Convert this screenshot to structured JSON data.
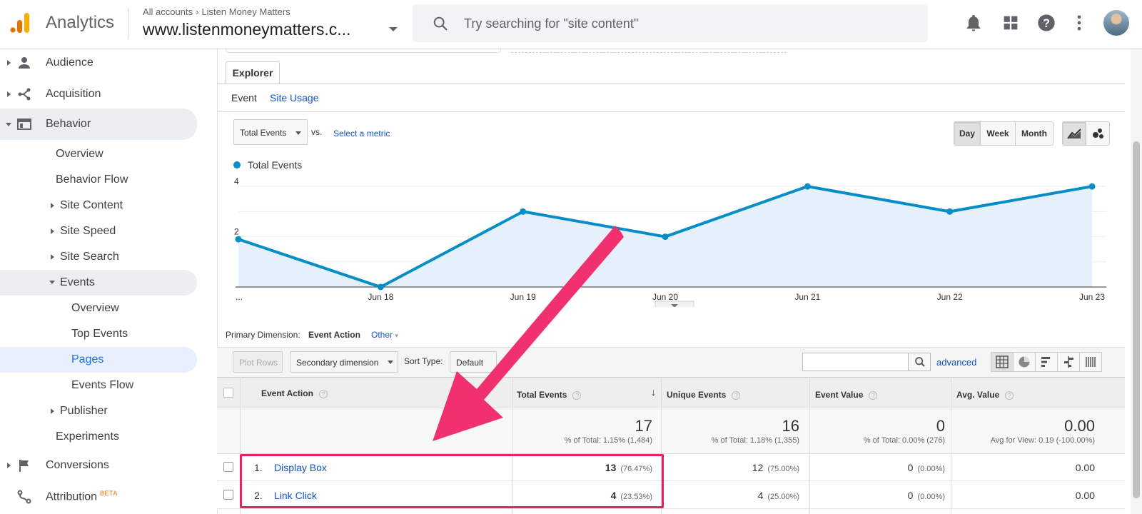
{
  "app": {
    "brand": "Analytics",
    "breadcrumb": [
      "All accounts",
      "Listen Money Matters"
    ],
    "property": "www.listenmoneymatters.c...",
    "search_placeholder": "Try searching for \"site content\""
  },
  "sidebar": {
    "items": [
      {
        "label": "Audience"
      },
      {
        "label": "Acquisition"
      },
      {
        "label": "Behavior"
      },
      {
        "label": "Overview"
      },
      {
        "label": "Behavior Flow"
      },
      {
        "label": "Site Content"
      },
      {
        "label": "Site Speed"
      },
      {
        "label": "Site Search"
      },
      {
        "label": "Events"
      },
      {
        "label": "Overview"
      },
      {
        "label": "Top Events"
      },
      {
        "label": "Pages"
      },
      {
        "label": "Events Flow"
      },
      {
        "label": "Publisher"
      },
      {
        "label": "Experiments"
      },
      {
        "label": "Conversions"
      },
      {
        "label": "Attribution"
      }
    ],
    "beta_badge": "BETA"
  },
  "explorer": {
    "tab": "Explorer",
    "subtabs": [
      "Event",
      "Site Usage"
    ],
    "metric_select": "Total Events",
    "vs": "vs.",
    "select_metric": "Select a metric",
    "period_buttons": [
      "Day",
      "Week",
      "Month"
    ],
    "active_period": "Day"
  },
  "chart_data": {
    "type": "area",
    "series": [
      {
        "name": "Total Events",
        "color": "#058dc7",
        "values": [
          1.9,
          0,
          3,
          2,
          4,
          3,
          4
        ]
      }
    ],
    "categories": [
      "...",
      "Jun 18",
      "Jun 19",
      "Jun 20",
      "Jun 21",
      "Jun 22",
      "Jun 23"
    ],
    "yticks": [
      "4",
      "2"
    ],
    "ylim": [
      0,
      4.6
    ],
    "grid": true
  },
  "table_controls": {
    "primary_dimension_label": "Primary Dimension:",
    "primary_dimension_value": "Event Action",
    "other": "Other",
    "plot_rows": "Plot Rows",
    "secondary_dimension": "Secondary dimension",
    "sort_type_label": "Sort Type:",
    "sort_type_value": "Default",
    "advanced": "advanced"
  },
  "table": {
    "headers": [
      "Event Action",
      "Total Events",
      "Unique Events",
      "Event Value",
      "Avg. Value"
    ],
    "totals": {
      "total_events": "17",
      "total_events_sub": "% of Total: 1.15% (1,484)",
      "unique_events": "16",
      "unique_events_sub": "% of Total: 1.18% (1,355)",
      "event_value": "0",
      "event_value_sub": "% of Total: 0.00% (276)",
      "avg_value": "0.00",
      "avg_value_sub": "Avg for View: 0.19 (-100.00%)"
    },
    "rows": [
      {
        "num": "1.",
        "action": "Display Box",
        "total": "13",
        "total_pct": "(76.47%)",
        "unique": "12",
        "unique_pct": "(75.00%)",
        "value": "0",
        "value_pct": "(0.00%)",
        "avg": "0.00"
      },
      {
        "num": "2.",
        "action": "Link Click",
        "total": "4",
        "total_pct": "(23.53%)",
        "unique": "4",
        "unique_pct": "(25.00%)",
        "value": "0",
        "value_pct": "(0.00%)",
        "avg": "0.00"
      }
    ]
  },
  "colors": {
    "accent": "#1a73e8",
    "chart": "#058dc7",
    "annotation": "#e91e63"
  }
}
